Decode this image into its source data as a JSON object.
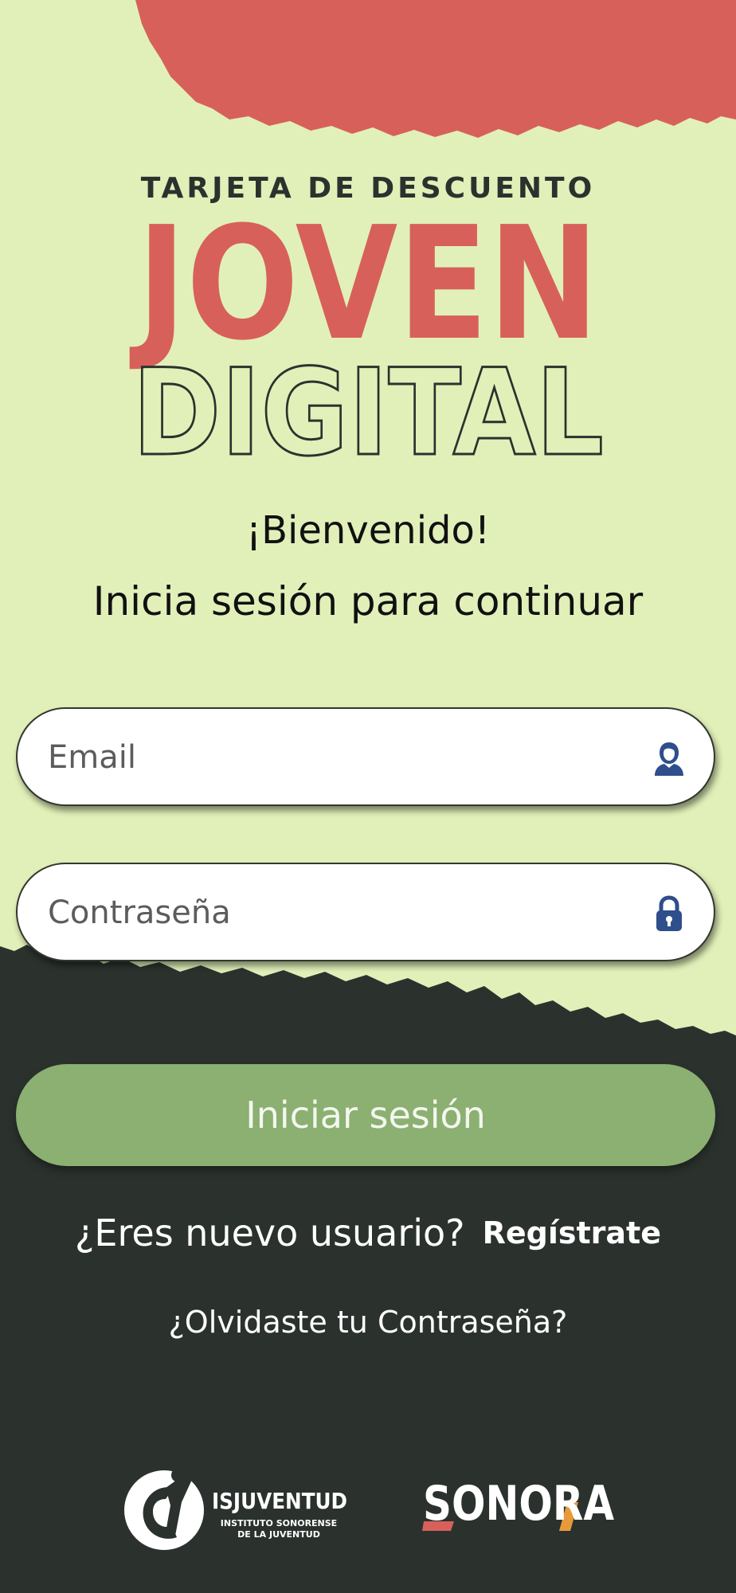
{
  "header": {
    "tagline": "TARJETA DE DESCUENTO",
    "title_line1": "JOVEN",
    "title_line2": "DIGITAL"
  },
  "welcome": {
    "greeting": "¡Bienvenido!",
    "subtitle": "Inicia sesión para continuar"
  },
  "form": {
    "email_placeholder": "Email",
    "password_placeholder": "Contraseña",
    "email_icon": "user-icon",
    "password_icon": "lock-icon",
    "submit_label": "Iniciar sesión"
  },
  "links": {
    "register_question": "¿Eres nuevo usuario?",
    "register_label": "Regístrate",
    "forgot_password": "¿Olvidaste tu Contraseña?"
  },
  "footer": {
    "isj_name": "ISJUVENTUD",
    "isj_sub1": "INSTITUTO SONORENSE",
    "isj_sub2": "DE LA JUVENTUD",
    "state_name": "SONORA"
  },
  "colors": {
    "background": "#e1f0b9",
    "accent_red": "#d8605a",
    "dark": "#2b322e",
    "button_green": "#8bb071",
    "icon_blue": "#2e4e8c"
  }
}
